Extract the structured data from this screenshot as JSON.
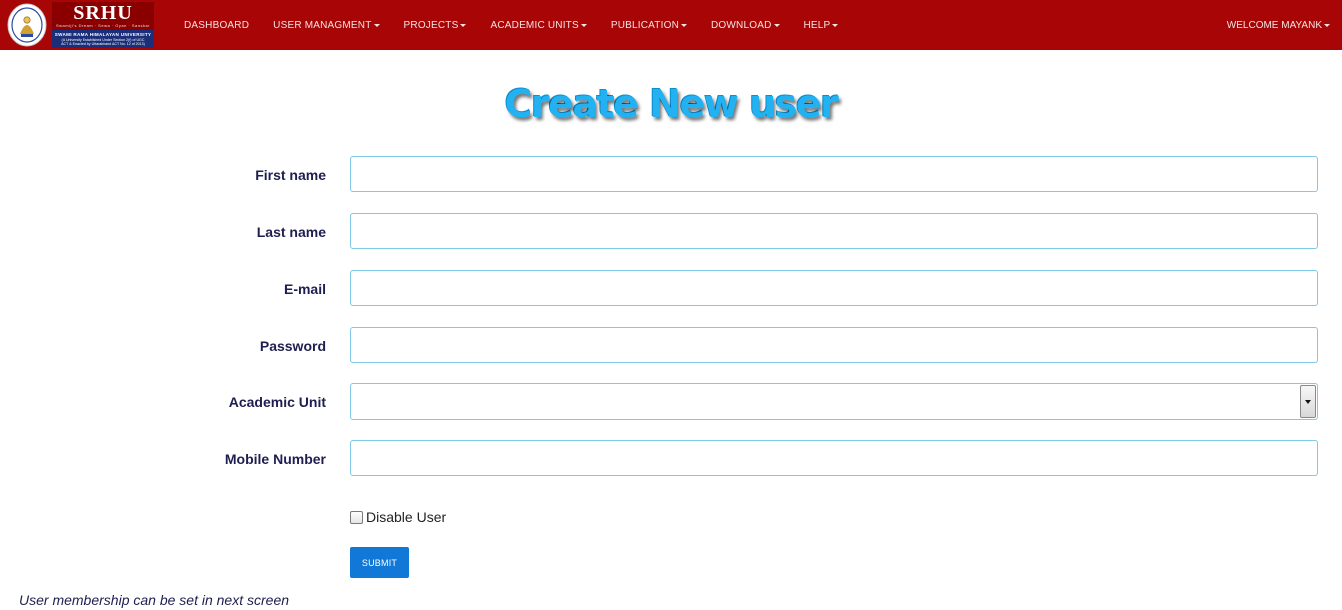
{
  "logo": {
    "title": "SRHU",
    "tagline": "Swamiji's Dream  ·  Sewa  ·  Gyan  ·  Sanskar",
    "university": "SWAMI RAMA HIMALAYAN UNIVERSITY",
    "sub_line_1": "(A University Established Under Section 2(f) of UGC",
    "sub_line_2": "ACT & Enacted by Uttarakhand ACT No. 12 of 2013)"
  },
  "nav": {
    "items": [
      {
        "label": "DASHBOARD",
        "dropdown": false
      },
      {
        "label": "USER MANAGMENT",
        "dropdown": true
      },
      {
        "label": "PROJECTS",
        "dropdown": true
      },
      {
        "label": "ACADEMIC UNITS",
        "dropdown": true
      },
      {
        "label": "PUBLICATION",
        "dropdown": true
      },
      {
        "label": "DOWNLOAD",
        "dropdown": true
      },
      {
        "label": "HELP",
        "dropdown": true
      }
    ],
    "welcome": "WELCOME MAYANK"
  },
  "page": {
    "title": "Create New user"
  },
  "form": {
    "first_name": {
      "label": "First name",
      "value": "",
      "placeholder": ""
    },
    "last_name": {
      "label": "Last name",
      "value": "",
      "placeholder": ""
    },
    "email": {
      "label": "E-mail",
      "value": "",
      "placeholder": ""
    },
    "password": {
      "label": "Password",
      "value": "",
      "placeholder": ""
    },
    "academic_unit": {
      "label": "Academic Unit",
      "selected": ""
    },
    "mobile": {
      "label": "Mobile Number",
      "value": "",
      "placeholder": ""
    },
    "disable_user": {
      "label": "Disable User",
      "checked": false
    },
    "submit_label": "SUBMIT"
  },
  "footer_note": "User membership can be set in next screen",
  "colors": {
    "navbar": "#a80606",
    "title": "#22b2f2",
    "label": "#1e1e50",
    "input_border": "#7fc8e6",
    "submit": "#1178d8"
  }
}
